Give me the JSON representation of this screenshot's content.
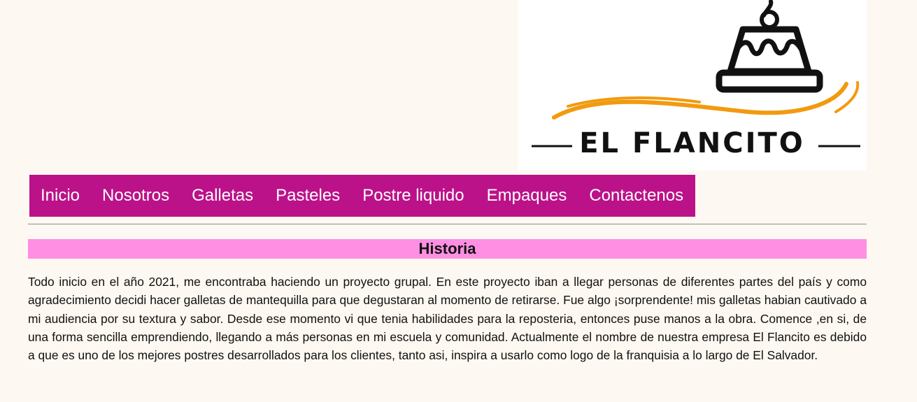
{
  "logo": {
    "brand_name": "EL FLANCITO",
    "icon": "flan-cake-icon",
    "colors": {
      "ink": "#111111",
      "swoosh": "#f29a0e"
    }
  },
  "nav": {
    "background": "#bb1289",
    "items": [
      {
        "label": "Inicio"
      },
      {
        "label": "Nosotros"
      },
      {
        "label": "Galletas"
      },
      {
        "label": "Pasteles"
      },
      {
        "label": "Postre liquido"
      },
      {
        "label": "Empaques"
      },
      {
        "label": "Contactenos"
      }
    ]
  },
  "history": {
    "title": "Historia",
    "title_background": "#ff8fe3",
    "body": "Todo inicio en el año 2021, me encontraba haciendo un proyecto grupal. En este proyecto iban a llegar personas de diferentes partes del país y como agradecimiento decidi hacer galletas de mantequilla para que degustaran al momento de retirarse. Fue algo ¡sorprendente! mis galletas habian cautivado a mi audiencia por su textura y sabor. Desde ese momento vi que tenia habilidades para la reposteria, entonces puse manos a la obra. Comence ,en si, de una forma sencilla emprendiendo, llegando a más personas en mi escuela y comunidad. Actualmente el nombre de nuestra empresa El Flancito es debido a que es uno de los mejores postres desarrollados para los clientes, tanto asi, inspira a usarlo como logo de la franquisia a lo largo de El Salvador."
  }
}
